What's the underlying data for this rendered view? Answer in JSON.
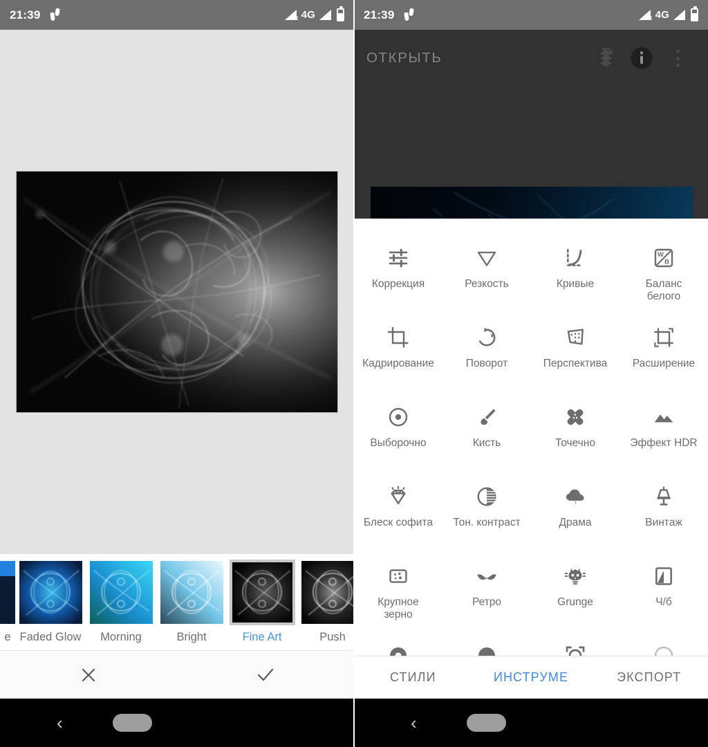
{
  "status_bar": {
    "time": "21:39",
    "pedometer_icon": "footsteps-icon",
    "signal_x_icon": "signal-no-sim-icon",
    "network": "4G",
    "signal_icon": "signal-bars-icon",
    "battery_icon": "battery-icon"
  },
  "left_screen": {
    "name": "snapseed-styles-screen",
    "photo": {
      "alt_name": "fractal-smoke-photo"
    },
    "filters": [
      {
        "label": "e",
        "partial": true,
        "selected": false,
        "style": "bright-blue"
      },
      {
        "label": "Faded Glow",
        "partial": false,
        "selected": false,
        "style": "faded-glow"
      },
      {
        "label": "Morning",
        "partial": false,
        "selected": false,
        "style": "morning"
      },
      {
        "label": "Bright",
        "partial": false,
        "selected": false,
        "style": "bright"
      },
      {
        "label": "Fine Art",
        "partial": false,
        "selected": true,
        "style": "fine-art"
      },
      {
        "label": "Push",
        "partial": false,
        "selected": false,
        "style": "push"
      }
    ],
    "actions": {
      "cancel_icon": "close-icon",
      "confirm_icon": "check-icon"
    }
  },
  "right_screen": {
    "name": "snapseed-tools-screen",
    "toolbar": {
      "open_label": "ОТКРЫТЬ",
      "stacks_icon": "undo-stack-icon",
      "info_icon": "info-icon",
      "overflow_icon": "more-vert-icon"
    },
    "tools": [
      {
        "label": "Коррекция",
        "icon": "tune-sliders-icon"
      },
      {
        "label": "Резкость",
        "icon": "sharpen-triangle-icon"
      },
      {
        "label": "Кривые",
        "icon": "curves-icon"
      },
      {
        "label": "Баланс белого",
        "icon": "white-balance-icon"
      },
      {
        "label": "Кадрирование",
        "icon": "crop-icon"
      },
      {
        "label": "Поворот",
        "icon": "rotate-icon"
      },
      {
        "label": "Перспектива",
        "icon": "perspective-icon"
      },
      {
        "label": "Расширение",
        "icon": "expand-icon"
      },
      {
        "label": "Выборочно",
        "icon": "selective-icon"
      },
      {
        "label": "Кисть",
        "icon": "brush-icon"
      },
      {
        "label": "Точечно",
        "icon": "healing-icon"
      },
      {
        "label": "Эффект HDR",
        "icon": "hdr-mountains-icon"
      },
      {
        "label": "Блеск софита",
        "icon": "glamour-glow-icon"
      },
      {
        "label": "Тон. контраст",
        "icon": "tonal-contrast-icon"
      },
      {
        "label": "Драма",
        "icon": "drama-cloud-icon"
      },
      {
        "label": "Винтаж",
        "icon": "vintage-lamp-icon"
      },
      {
        "label": "Крупное зерно",
        "icon": "grainy-film-icon"
      },
      {
        "label": "Ретро",
        "icon": "retrolux-moustache-icon"
      },
      {
        "label": "Grunge",
        "icon": "grunge-skull-icon"
      },
      {
        "label": "Ч/б",
        "icon": "black-white-icon"
      }
    ],
    "tabs": [
      {
        "label": "СТИЛИ",
        "active": false
      },
      {
        "label": "ИНСТРУМЕ",
        "active": true
      },
      {
        "label": "ЭКСПОРТ",
        "active": false
      }
    ]
  },
  "nav_bar": {
    "back_icon": "back-chevron-icon",
    "home_pill_icon": "home-pill-icon"
  },
  "colors": {
    "accent_blue": "#3d8ae0",
    "status_bar_gray": "#6e6e6e",
    "toolbar_dark": "#323232",
    "canvas_gray": "#e3e3e3",
    "icon_gray": "#6d6d6d"
  }
}
